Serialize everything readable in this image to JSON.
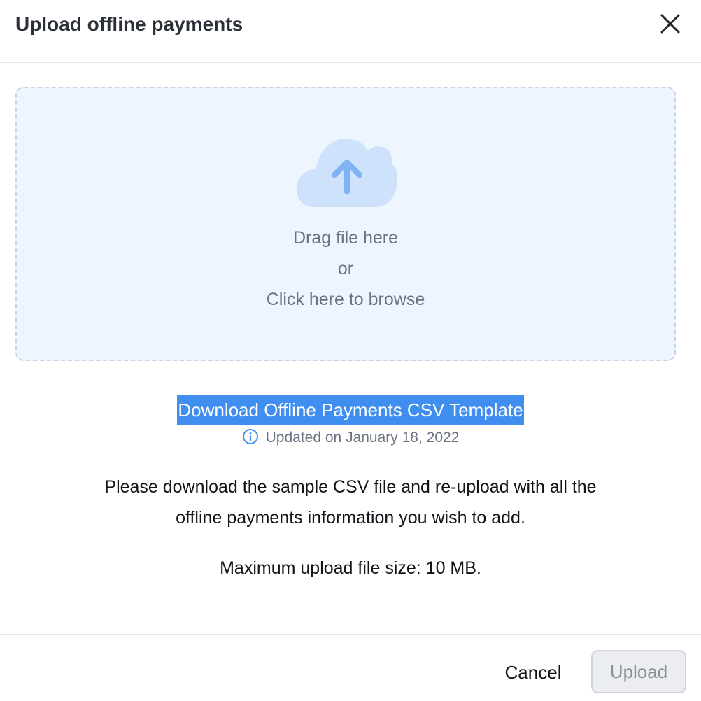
{
  "dialog": {
    "title": "Upload offline payments",
    "close_icon": "close-icon"
  },
  "dropzone": {
    "icon": "cloud-upload-icon",
    "line1": "Drag file here",
    "line2": "or",
    "line3": "Click here to browse"
  },
  "template": {
    "link_label": "Download Offline Payments CSV Template",
    "info_icon": "info-icon",
    "updated_text": "Updated on January 18, 2022"
  },
  "description": {
    "line1": "Please download the sample CSV file and re-upload with all the",
    "line2": "offline payments information you wish to add."
  },
  "max_size_text": "Maximum upload file size: 10 MB.",
  "footer": {
    "cancel_label": "Cancel",
    "upload_label": "Upload"
  },
  "colors": {
    "highlight": "#3f8ef0",
    "dropzone_bg": "#eff5fe",
    "cloud": "#cfe2fc",
    "arrow": "#7fb3f3"
  }
}
